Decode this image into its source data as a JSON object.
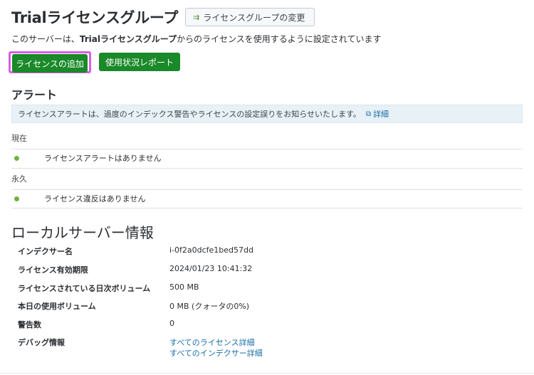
{
  "header": {
    "title": "Trialライセンスグループ",
    "change_button": "ライセンスグループの変更",
    "subtitle_prefix": "このサーバーは、",
    "subtitle_group": "Trialライセンスグループ",
    "subtitle_suffix": "からのライセンスを使用するように設定されています"
  },
  "actions": {
    "add_license": "ライセンスの追加",
    "usage_report": "使用状況レポート"
  },
  "alerts": {
    "heading": "アラート",
    "info_text": "ライセンスアラートは、過度のインデックス警告やライセンスの設定誤りをお知らせいたします。",
    "info_link": "詳細",
    "current_label": "現在",
    "current_message": "ライセンスアラートはありません",
    "permanent_label": "永久",
    "permanent_message": "ライセンス違反はありません",
    "status_color": "#6cb33f"
  },
  "server_info": {
    "heading": "ローカルサーバー情報",
    "rows": [
      {
        "key": "インデクサー名",
        "value": "i-0f2a0dcfe1bed57dd"
      },
      {
        "key": "ライセンス有効期限",
        "value": "2024/01/23 10:41:32"
      },
      {
        "key": "ライセンスされている日次ボリューム",
        "value": "500 MB"
      },
      {
        "key": "本日の使用ボリューム",
        "value": "0 MB (クォータの0%)"
      },
      {
        "key": "警告数",
        "value": "0"
      },
      {
        "key": "デバッグ情報",
        "links": [
          "すべてのライセンス詳細",
          "すべてのインデクサー詳細"
        ]
      }
    ]
  },
  "colors": {
    "primary_button": "#1a8929",
    "highlight": "#d85fe4",
    "link": "#1a6fa8"
  }
}
